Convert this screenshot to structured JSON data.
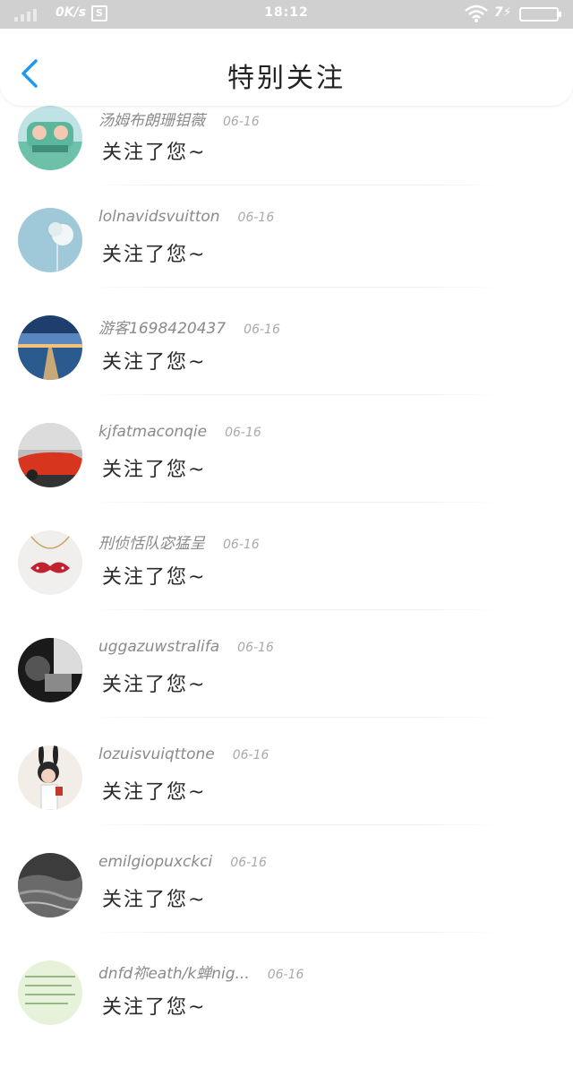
{
  "status_bar": {
    "speed": "0K/s",
    "time": "18:12",
    "charge_label": "7",
    "icons": [
      "signal-icon",
      "screenshot-icon",
      "wifi-icon",
      "charging-icon",
      "battery-icon"
    ]
  },
  "header": {
    "title": "特别关注",
    "back_icon": "chevron-left-icon",
    "accent_color": "#2196f3"
  },
  "items": [
    {
      "name": "汤姆布朗珊钼薇",
      "date": "06-16",
      "message": "关注了您~",
      "avatar": "cartoon-car"
    },
    {
      "name": "lolnavidsvuitton",
      "date": "06-16",
      "message": "关注了您~",
      "avatar": "flower"
    },
    {
      "name": "游客1698420437",
      "date": "06-16",
      "message": "关注了您~",
      "avatar": "lake-pier"
    },
    {
      "name": "kjfatmaconqie",
      "date": "06-16",
      "message": "关注了您~",
      "avatar": "red-car"
    },
    {
      "name": "刑侦恬队宓猛呈",
      "date": "06-16",
      "message": "关注了您~",
      "avatar": "mustache-necklace"
    },
    {
      "name": "uggazuwstralifa",
      "date": "06-16",
      "message": "关注了您~",
      "avatar": "bw-photo"
    },
    {
      "name": "lozuisvuiqttone",
      "date": "06-16",
      "message": "关注了您~",
      "avatar": "bunny-girl"
    },
    {
      "name": "emilgiopuxckci",
      "date": "06-16",
      "message": "关注了您~",
      "avatar": "sea-waves"
    },
    {
      "name": "dnfd祢eath/k蝉nig...",
      "date": "06-16",
      "message": "关注了您~",
      "avatar": "handwriting"
    }
  ]
}
